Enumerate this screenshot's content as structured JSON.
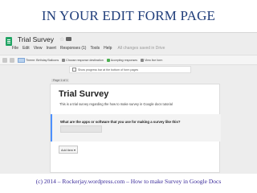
{
  "slide": {
    "title": "IN YOUR EDIT FORM PAGE",
    "footer": "(c) 2014 – Rockerjay.wordpress.com – How to make Survey in Google Docs"
  },
  "app": {
    "doc_title": "Trial Survey",
    "menu": [
      "File",
      "Edit",
      "View",
      "Insert",
      "Responses (1)",
      "Tools",
      "Help"
    ],
    "saved_status": "All changes saved in Drive"
  },
  "toolbar": {
    "theme": "Theme: Birthday Balloons",
    "destination": "Choose response destination",
    "accepting": "Accepting responses",
    "view_form": "View live form"
  },
  "progress": {
    "label": "Show progress bar at the bottom of form pages"
  },
  "form": {
    "page_label": "Page 1 of 1",
    "title": "Trial Survey",
    "description": "This is a trial survey regarding the how to make survey in Google docs tutorial",
    "question": "What are the apps or software that you use for making a survey like this?",
    "add_item": "Add item ▾"
  },
  "colors": {
    "slide_title": "#1f3d7a",
    "footer": "#3a2a9a",
    "forms_green": "#21a464",
    "question_accent": "#4d90fe"
  }
}
